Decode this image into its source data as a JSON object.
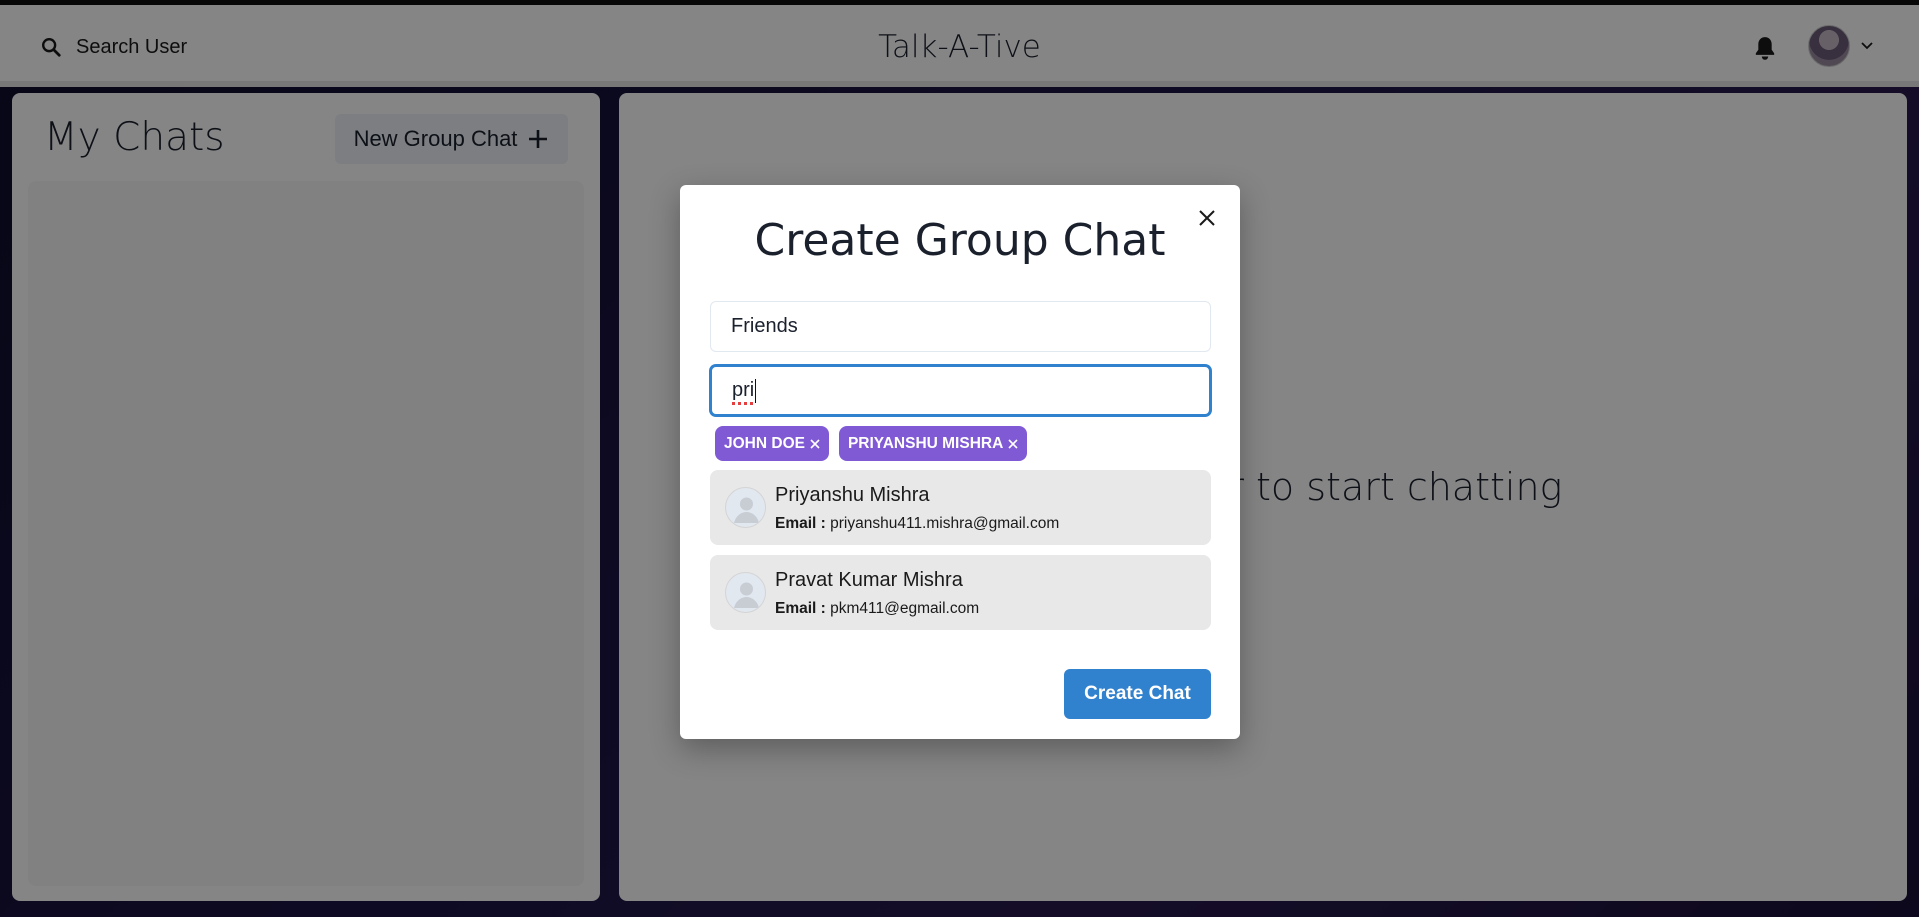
{
  "header": {
    "search_label": "Search User",
    "app_title": "Talk-A-Tive"
  },
  "sidebar": {
    "title": "My Chats",
    "new_group_label": "New Group Chat"
  },
  "main": {
    "placeholder": "Click on a user to start chatting"
  },
  "modal": {
    "title": "Create Group Chat",
    "chat_name_value": "Friends",
    "search_value": "pri",
    "selected_users": [
      {
        "label": "JOHN DOE"
      },
      {
        "label": "PRIYANSHU MISHRA"
      }
    ],
    "results": [
      {
        "name": "Priyanshu Mishra",
        "email_label": "Email :",
        "email": "priyanshu411.mishra@gmail.com"
      },
      {
        "name": "Pravat Kumar Mishra",
        "email_label": "Email :",
        "email": "pkm411@egmail.com"
      }
    ],
    "create_label": "Create Chat"
  },
  "colors": {
    "accent_blue": "#3182ce",
    "tag_purple": "#805ad5",
    "overlay": "rgba(0,0,0,0.48)"
  },
  "icons": {
    "search": "search-icon",
    "bell": "bell-icon",
    "chevron": "chevron-down-icon",
    "add": "plus-icon",
    "close": "close-icon",
    "tag_remove": "close-icon",
    "user": "user-avatar-icon"
  }
}
